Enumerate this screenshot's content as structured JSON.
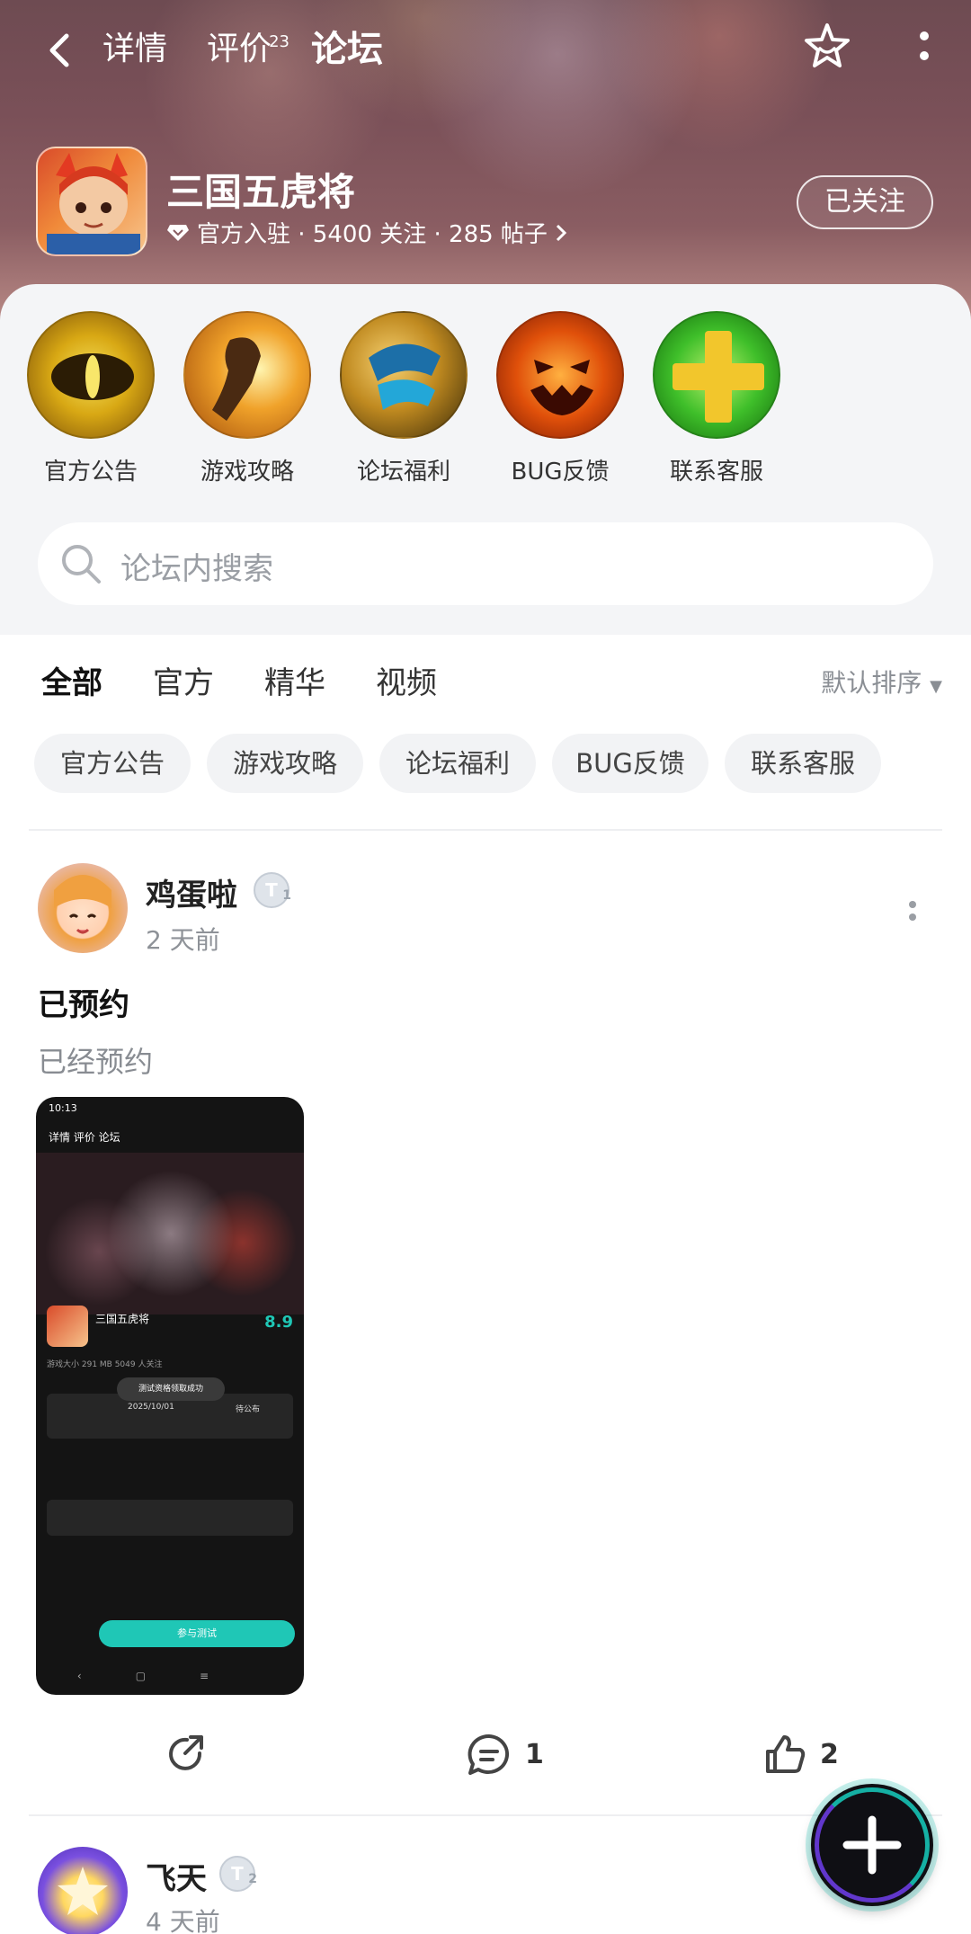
{
  "nav": {
    "tabs": [
      {
        "label": "详情"
      },
      {
        "label": "评价",
        "count": "23"
      },
      {
        "label": "论坛"
      }
    ]
  },
  "game": {
    "title": "三国五虎将",
    "meta": "官方入驻 · 5400 关注 · 285 帖子",
    "follow_label": "已关注"
  },
  "quick_links": [
    {
      "label": "官方公告"
    },
    {
      "label": "游戏攻略"
    },
    {
      "label": "论坛福利"
    },
    {
      "label": "BUG反馈"
    },
    {
      "label": "联系客服"
    }
  ],
  "search": {
    "placeholder": "论坛内搜索"
  },
  "filter_tabs": [
    {
      "label": "全部"
    },
    {
      "label": "官方"
    },
    {
      "label": "精华"
    },
    {
      "label": "视频"
    }
  ],
  "sort_label": "默认排序",
  "chips": [
    {
      "label": "官方公告"
    },
    {
      "label": "游戏攻略"
    },
    {
      "label": "论坛福利"
    },
    {
      "label": "BUG反馈"
    },
    {
      "label": "联系客服"
    }
  ],
  "posts": [
    {
      "author": "鸡蛋啦",
      "level": "1",
      "time": "2 天前",
      "title": "已预约",
      "body": "已经预约",
      "comments": "1",
      "likes": "2",
      "image": {
        "status_time": "10:13",
        "tabs": "详情   评价   论坛",
        "game_name": "三国五虎将",
        "score": "8.9",
        "line1": "游戏大小 291 MB    5049 人关注",
        "toast": "测试资格领取成功",
        "date": "2025/10/01",
        "pending": "待公布",
        "join_label": "参与测试",
        "nav_glyphs": "‹▢≡"
      }
    },
    {
      "author": "飞天",
      "level": "2",
      "time": "4 天前"
    }
  ],
  "colors": {
    "accent": "#16c2b4",
    "chip_bg": "#f2f3f5",
    "panel_bg": "#f4f5f7"
  }
}
